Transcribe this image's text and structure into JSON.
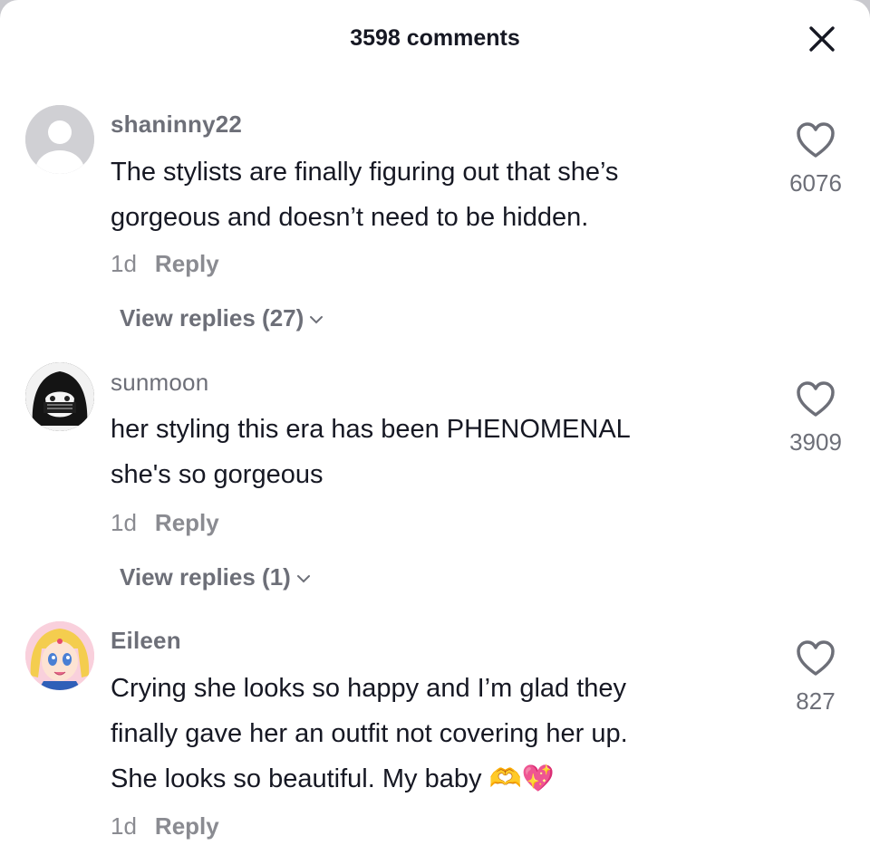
{
  "header": {
    "title": "3598 comments"
  },
  "comments": [
    {
      "username": "shaninny22",
      "line1": "The stylists are finally figuring out that she’s",
      "line2": "gorgeous and doesn’t need to be hidden.",
      "age": "1d",
      "reply_label": "Reply",
      "view_replies": "View replies (27)",
      "likes": "6076"
    },
    {
      "username": "sunmoon",
      "line1": "her styling this era has been PHENOMENAL",
      "line2": "she's so gorgeous",
      "age": "1d",
      "reply_label": "Reply",
      "view_replies": "View replies (1)",
      "likes": "3909"
    },
    {
      "username": "Eileen",
      "line1": "Crying she looks so happy and I’m glad they",
      "line2": "finally gave her an outfit not covering her up.",
      "line3": "She looks so beautiful. My baby 🫶💖",
      "age": "1d",
      "reply_label": "Reply",
      "likes": "827"
    }
  ],
  "icons": {
    "close": "close-icon",
    "like": "heart-outline-icon",
    "chevron": "chevron-down-icon"
  },
  "colors": {
    "text": "#161823",
    "muted": "#8a8b91",
    "username": "#6d6f78"
  }
}
